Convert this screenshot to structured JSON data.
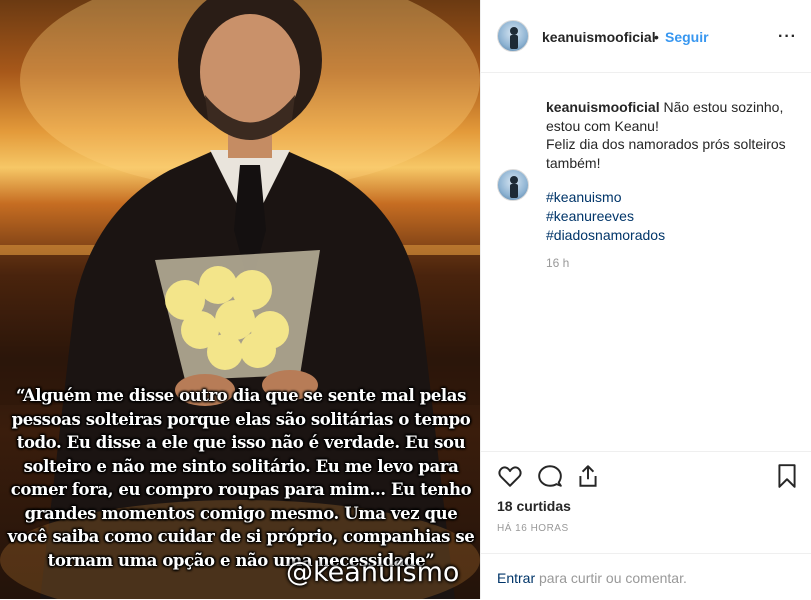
{
  "post": {
    "quote": "“Alguém me disse outro dia que se sente mal pelas pessoas solteiras porque elas são solitárias o tempo todo. Eu disse a ele que isso não é verdade. Eu sou solteiro e não me sinto solitário. Eu me levo para comer fora, eu compro roupas para mim... Eu tenho grandes momentos comigo mesmo. Uma vez que você saiba como cuidar de si próprio, companhias se tornam uma opção e não uma necessidade”",
    "watermark": "@keanuísmo"
  },
  "header": {
    "username": "keanuismooficial",
    "separator": "•",
    "follow_label": "Seguir",
    "more_icon": "more-options-icon"
  },
  "caption": {
    "username": "keanuismooficial",
    "line1": "Não estou sozinho, estou com Keanu!",
    "line2": "Feliz dia dos namorados prós solteiros também!",
    "hashtags": [
      "#keanuismo",
      "#keanureeves",
      "#diadosnamorados"
    ],
    "time": "16 h"
  },
  "actions": {
    "icons": [
      "heart-icon",
      "comment-icon",
      "share-icon",
      "bookmark-icon"
    ],
    "likes": "18 curtidas",
    "age": "HÁ 16 HORAS"
  },
  "comment_bar": {
    "login_link": "Entrar",
    "rest": " para curtir ou comentar."
  },
  "colors": {
    "link": "#3897f0",
    "hashtag": "#003569",
    "muted": "#999999"
  }
}
